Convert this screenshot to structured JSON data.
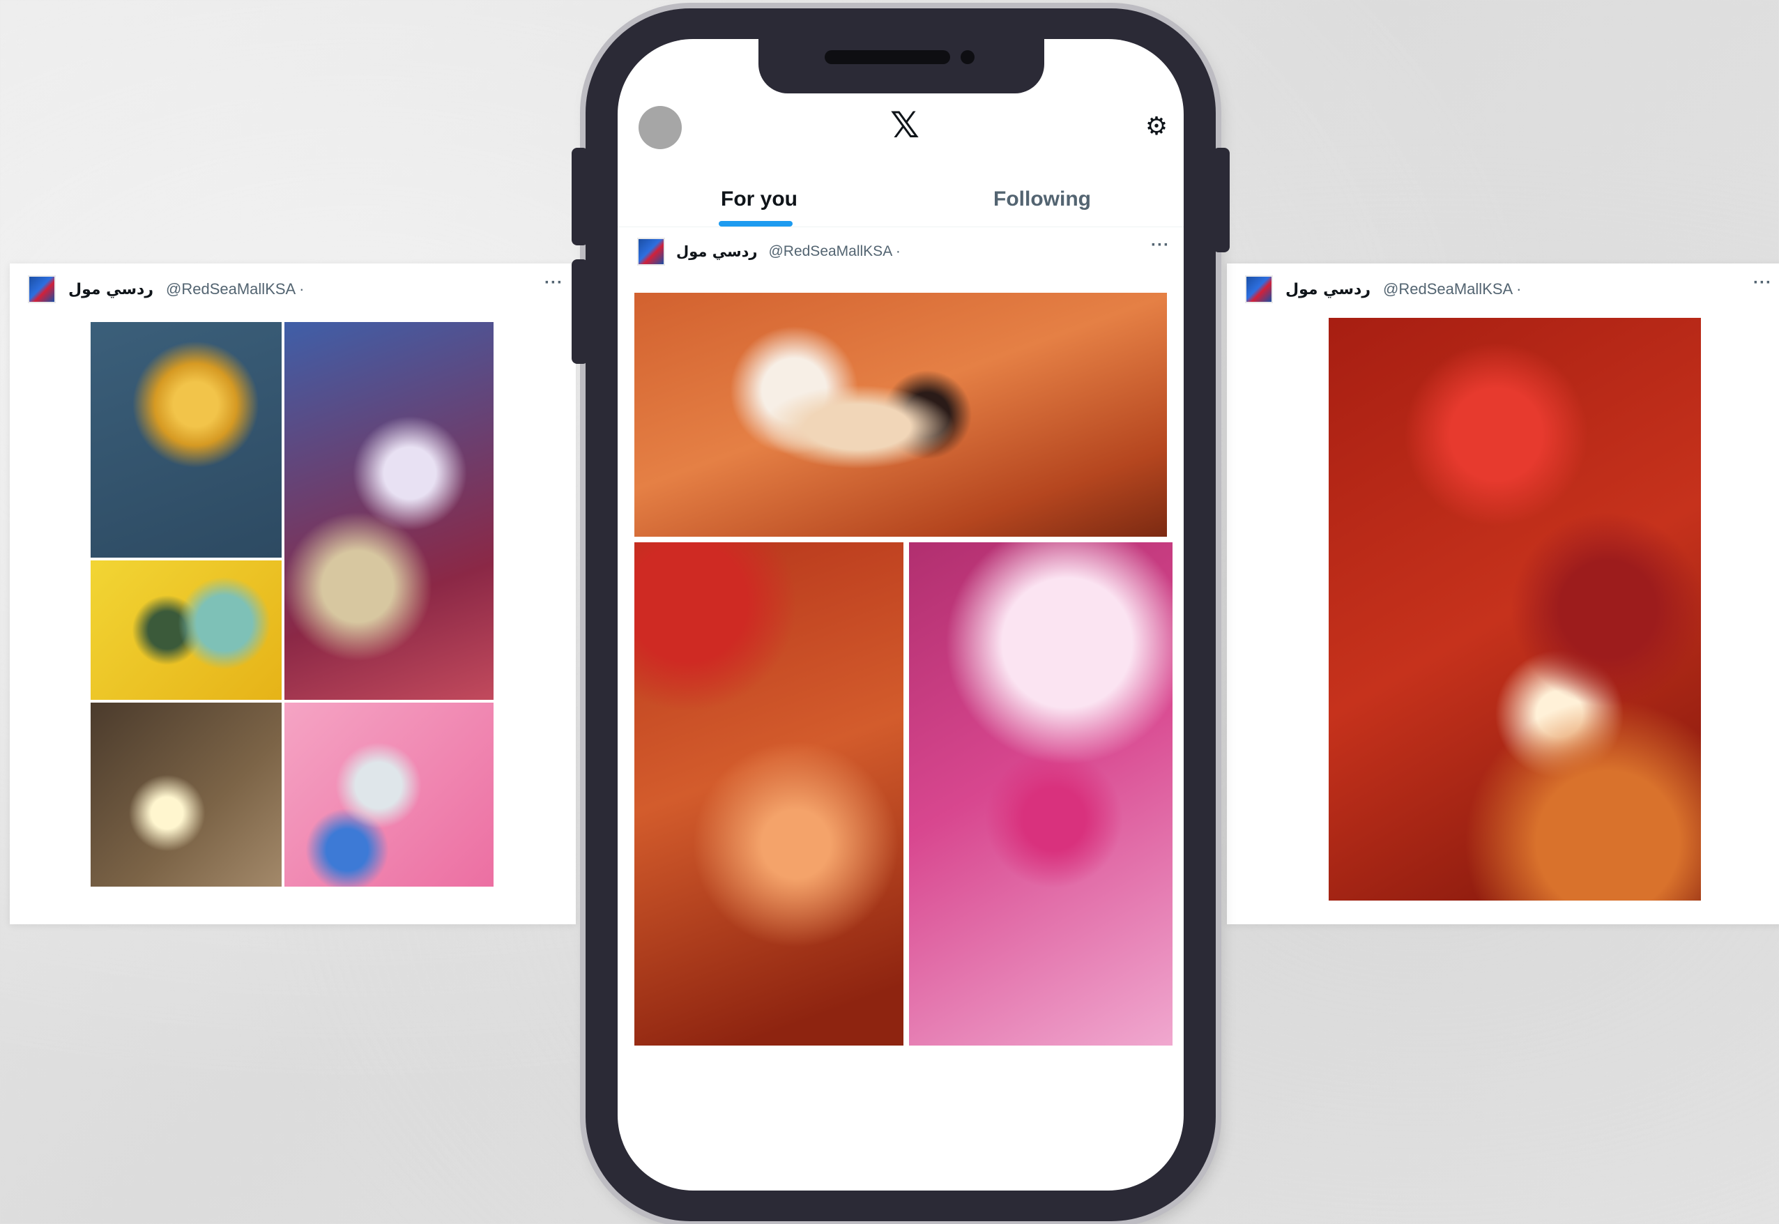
{
  "left_tweet": {
    "author_name": "ردسي مول",
    "handle": "@RedSeaMallKSA ·",
    "more_icon": "more-horizontal-icon",
    "more_label": "···"
  },
  "phone": {
    "header": {
      "logo": "𝕏",
      "settings_icon": "⚙"
    },
    "tabs": [
      {
        "label": "For you"
      },
      {
        "label": "Following"
      }
    ],
    "tweet": {
      "author_name": "ردسي مول",
      "handle": "@RedSeaMallKSA ·",
      "more_label": "···"
    }
  },
  "right_tweet": {
    "author_name": "ردسي مول",
    "handle": "@RedSeaMallKSA ·",
    "more_label": "···"
  },
  "colors": {
    "accent": "#1d9bf0",
    "phone_body": "#2b2a36",
    "text_primary": "#0f1419",
    "text_secondary": "#536471"
  }
}
